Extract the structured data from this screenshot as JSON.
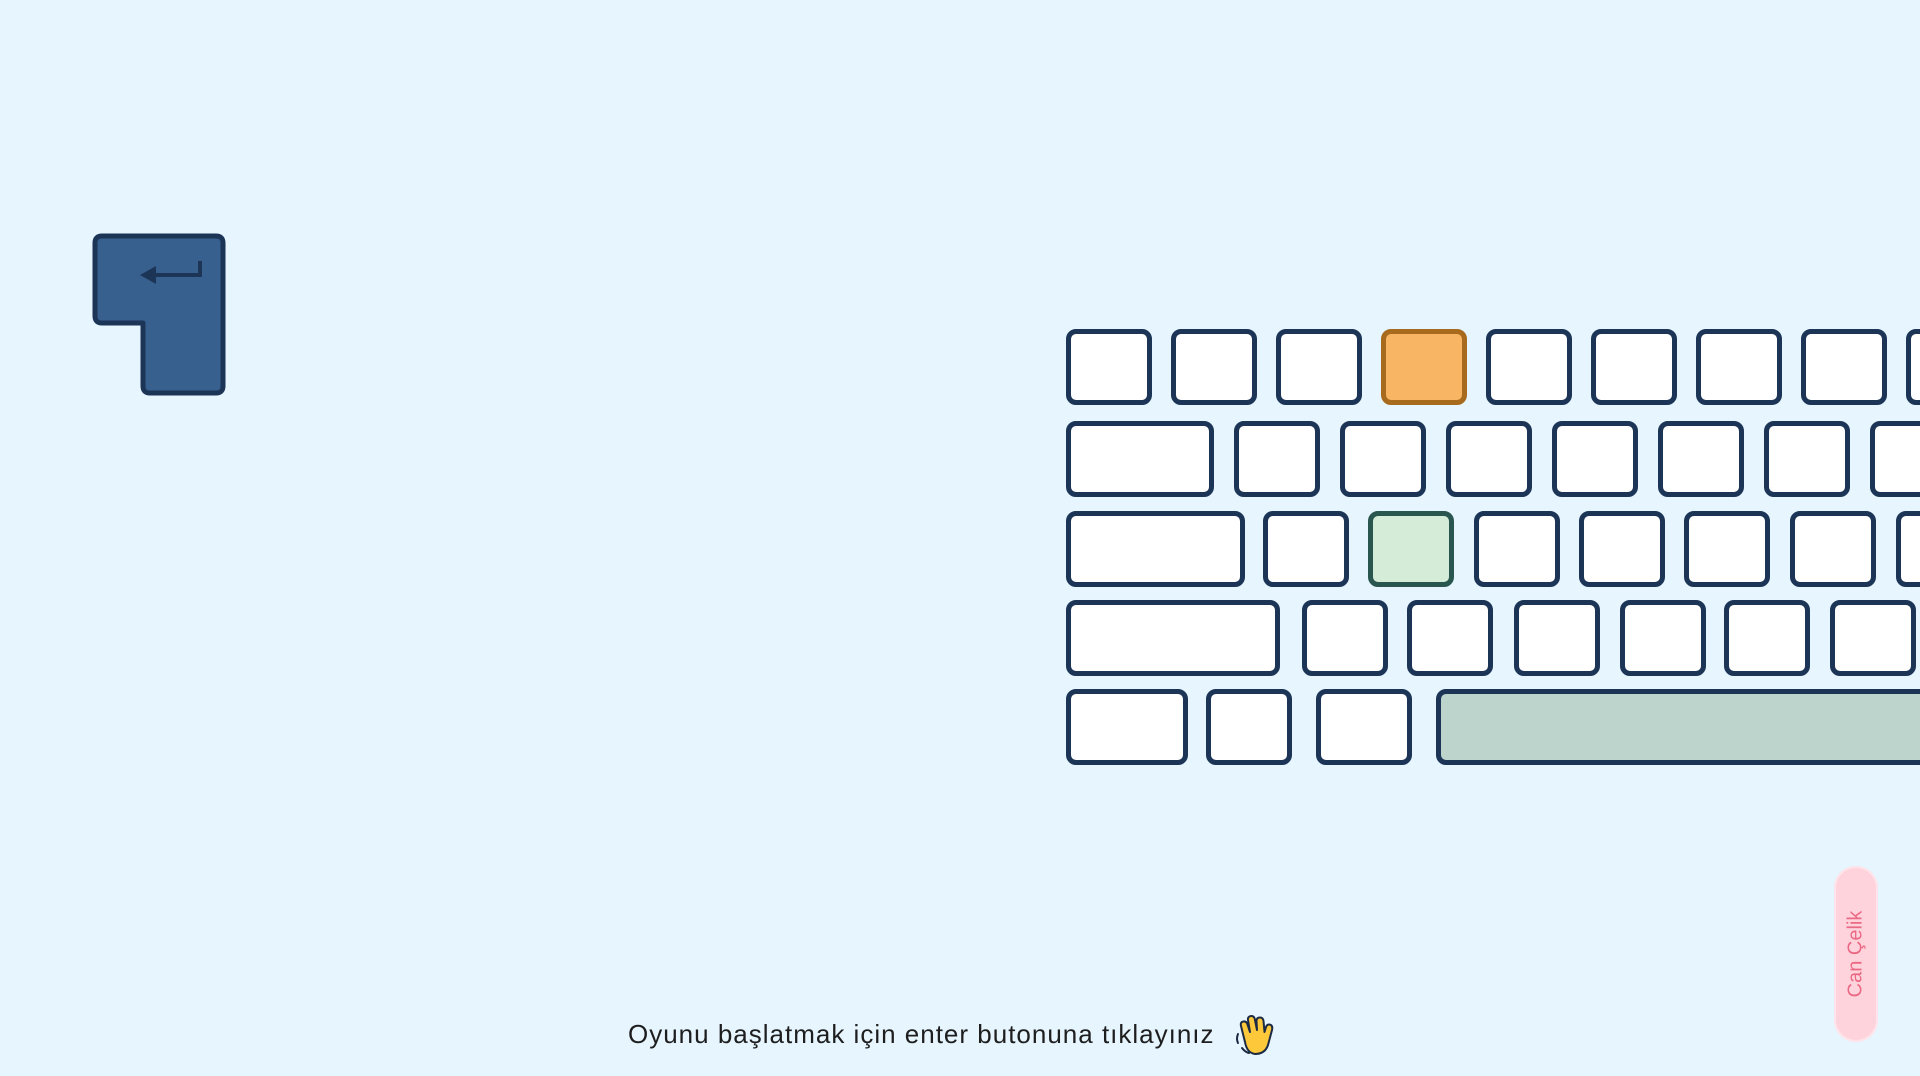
{
  "instruction": {
    "text": "Oyunu başlatmak için enter butonuna tıklayınız",
    "icon": "waving-hand-icon"
  },
  "author": {
    "name": "Can Çelik"
  },
  "enter_key": {
    "icon": "return-arrow-icon",
    "color": "#37608f"
  },
  "keyboard": {
    "key_color": "#ffffff",
    "border_color": "#1c3557",
    "highlight_orange": "#f8b665",
    "highlight_green": "#d4ecd8",
    "space_color": "#bdd4cc"
  },
  "colors": {
    "background": "#e6f5fe",
    "author_badge": "#ffd3dc",
    "author_text": "#ea6a85"
  }
}
